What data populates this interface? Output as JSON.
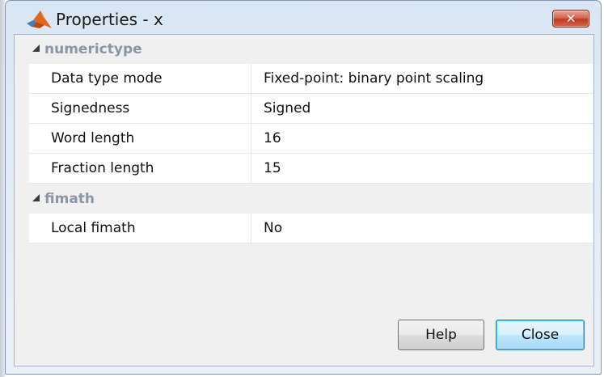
{
  "window": {
    "title": "Properties - x",
    "close_glyph": "✕",
    "app_icon": "matlab-logo-icon"
  },
  "sections": [
    {
      "label": "numerictype",
      "rows": [
        {
          "name": "Data type mode",
          "value": "Fixed-point: binary point scaling"
        },
        {
          "name": "Signedness",
          "value": "Signed"
        },
        {
          "name": "Word length",
          "value": "16"
        },
        {
          "name": "Fraction length",
          "value": "15"
        }
      ]
    },
    {
      "label": "fimath",
      "rows": [
        {
          "name": "Local fimath",
          "value": "No"
        }
      ]
    }
  ],
  "buttons": {
    "help": "Help",
    "close": "Close"
  },
  "colors": {
    "section_label": "#8a96a6",
    "close_button_red": "#c0391f",
    "focused_button_border": "#3c7fb1"
  }
}
